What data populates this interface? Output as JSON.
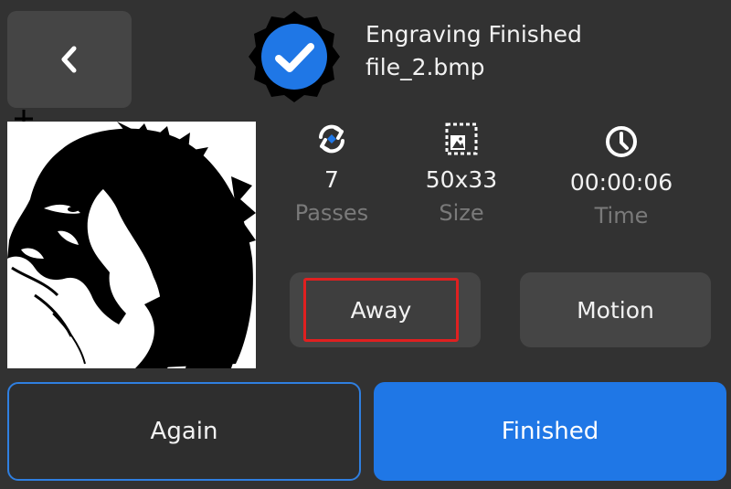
{
  "header": {
    "title": "Engraving Finished",
    "filename": "file_2.bmp"
  },
  "icons": {
    "back": "chevron-left-icon",
    "status": "check-badge-icon",
    "passes": "repeat-icon",
    "size": "image-size-icon",
    "time": "clock-icon"
  },
  "stats": {
    "passes": {
      "value": "7",
      "label": "Passes"
    },
    "size": {
      "value": "50x33",
      "label": "Size"
    },
    "time": {
      "value": "00:00:06",
      "label": "Time"
    }
  },
  "modes": {
    "away_label": "Away",
    "motion_label": "Motion"
  },
  "actions": {
    "again_label": "Again",
    "finished_label": "Finished"
  },
  "colors": {
    "background": "#323232",
    "accent": "#1f77e6",
    "highlight": "#e02020"
  }
}
